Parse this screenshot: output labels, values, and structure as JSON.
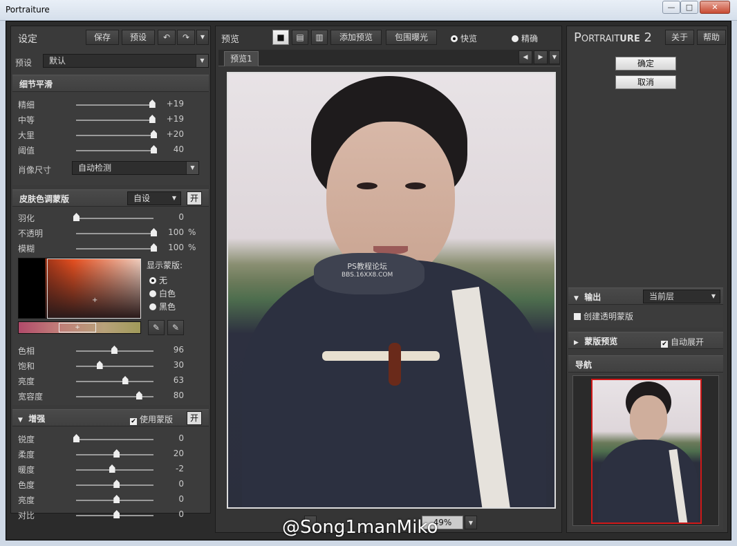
{
  "window": {
    "title": "Portraiture",
    "min": "—",
    "max": "□",
    "close": "✕"
  },
  "left": {
    "header": "设定",
    "save": "保存",
    "preset_btn": "预设",
    "undo": "↶",
    "redo": "↷",
    "menu": "▼",
    "preset_label": "预设",
    "preset_value": "默认",
    "detail": {
      "title": "细节平滑",
      "rows": [
        {
          "label": "精细",
          "value": "+19",
          "pos": 0.98
        },
        {
          "label": "中等",
          "value": "+19",
          "pos": 0.98
        },
        {
          "label": "大里",
          "value": "+20",
          "pos": 1.0
        },
        {
          "label": "阈值",
          "value": "40",
          "pos": 1.0
        }
      ],
      "size_label": "肖像尺寸",
      "size_value": "自动检测"
    },
    "skin": {
      "title": "皮肤色调蒙版",
      "mode": "自设",
      "toggle": "开",
      "rows": [
        {
          "label": "羽化",
          "value": "0",
          "unit": "",
          "pos": 0.0
        },
        {
          "label": "不透明",
          "value": "100",
          "unit": "%",
          "pos": 1.0
        },
        {
          "label": "模糊",
          "value": "100",
          "unit": "%",
          "pos": 1.0
        }
      ],
      "show_mask": "显示蒙版:",
      "mask_opts": [
        "无",
        "白色",
        "黑色"
      ],
      "mask_selected": 0,
      "color_rows": [
        {
          "label": "色相",
          "value": "96",
          "pos": 0.49
        },
        {
          "label": "饱和",
          "value": "30",
          "pos": 0.3
        },
        {
          "label": "亮度",
          "value": "63",
          "pos": 0.63
        },
        {
          "label": "宽容度",
          "value": "80",
          "pos": 0.81
        }
      ]
    },
    "enhance": {
      "title": "增强",
      "use_mask": "使用蒙版",
      "toggle": "开",
      "rows": [
        {
          "label": "锐度",
          "value": "0",
          "pos": 0.0
        },
        {
          "label": "柔度",
          "value": "20",
          "pos": 0.52
        },
        {
          "label": "暖度",
          "value": "-2",
          "pos": 0.46
        },
        {
          "label": "色度",
          "value": "0",
          "pos": 0.52
        },
        {
          "label": "亮度",
          "value": "0",
          "pos": 0.52
        },
        {
          "label": "对比",
          "value": "0",
          "pos": 0.52
        }
      ]
    }
  },
  "center": {
    "header": "预览",
    "add_preview": "添加预览",
    "bracket": "包围曝光",
    "fast": "快览",
    "accurate": "精确",
    "tab": "预览1",
    "watermark1": "PS教程论坛",
    "watermark2": "BBS.16XX8.COM",
    "zoom": "49%",
    "credit": "@Song1manMiko"
  },
  "right": {
    "brand_a": "P",
    "brand_b": "ORTRAIT",
    "brand_c": "URE",
    "brand_ver": "2",
    "about": "关于",
    "help": "帮助",
    "ok": "确定",
    "cancel": "取消",
    "output": {
      "title": "输出",
      "value": "当前层",
      "create_mask": "创建透明蒙版"
    },
    "mask_preview": {
      "title": "蒙版预览",
      "auto": "自动展开"
    },
    "navigator": "导航"
  },
  "colors": {
    "accent_red": "#d01818"
  }
}
